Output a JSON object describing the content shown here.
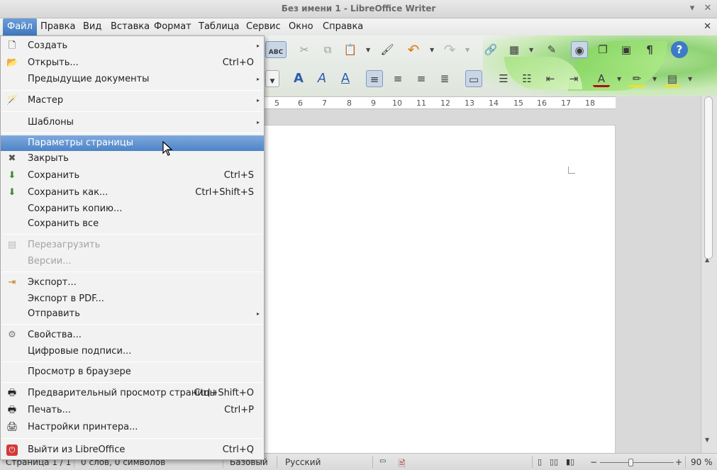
{
  "window": {
    "title": "Без имени 1 - LibreOffice Writer",
    "minimize_glyph": "▾",
    "close_glyph": "✕"
  },
  "menubar": {
    "items": [
      "Файл",
      "Правка",
      "Вид",
      "Вставка",
      "Формат",
      "Таблица",
      "Сервис",
      "Окно",
      "Справка"
    ],
    "close_doc_glyph": "✕"
  },
  "toolbar": {
    "abc_label": "ABC",
    "pilcrow": "¶",
    "help": "?",
    "fontwork_letter": "A"
  },
  "ruler": {
    "numbers": [
      "5",
      "6",
      "7",
      "8",
      "9",
      "10",
      "11",
      "12",
      "13",
      "14",
      "15",
      "16",
      "17",
      "18"
    ]
  },
  "file_menu": {
    "items": [
      {
        "label": "Создать",
        "shortcut": "",
        "submenu": true,
        "icon": "new-document-icon",
        "disabled": false,
        "highlighted": false
      },
      {
        "label": "Открыть...",
        "shortcut": "Ctrl+O",
        "submenu": false,
        "icon": "open-folder-icon",
        "disabled": false,
        "highlighted": false
      },
      {
        "label": "Предыдущие документы",
        "shortcut": "",
        "submenu": true,
        "icon": "",
        "disabled": false,
        "highlighted": false
      },
      {
        "label": "Мастер",
        "shortcut": "",
        "submenu": true,
        "icon": "wizard-icon",
        "disabled": false,
        "highlighted": false
      },
      {
        "label": "Шаблоны",
        "shortcut": "",
        "submenu": true,
        "icon": "",
        "disabled": false,
        "highlighted": false
      },
      {
        "label": "Параметры страницы",
        "shortcut": "",
        "submenu": false,
        "icon": "",
        "disabled": false,
        "highlighted": true
      },
      {
        "label": "Закрыть",
        "shortcut": "",
        "submenu": false,
        "icon": "close-x-icon",
        "disabled": false,
        "highlighted": false
      },
      {
        "label": "Сохранить",
        "shortcut": "Ctrl+S",
        "submenu": false,
        "icon": "save-icon",
        "disabled": false,
        "highlighted": false
      },
      {
        "label": "Сохранить как...",
        "shortcut": "Ctrl+Shift+S",
        "submenu": false,
        "icon": "save-as-icon",
        "disabled": false,
        "highlighted": false
      },
      {
        "label": "Сохранить копию...",
        "shortcut": "",
        "submenu": false,
        "icon": "",
        "disabled": false,
        "highlighted": false
      },
      {
        "label": "Сохранить все",
        "shortcut": "",
        "submenu": false,
        "icon": "",
        "disabled": false,
        "highlighted": false
      },
      {
        "label": "Перезагрузить",
        "shortcut": "",
        "submenu": false,
        "icon": "reload-icon",
        "disabled": true,
        "highlighted": false
      },
      {
        "label": "Версии...",
        "shortcut": "",
        "submenu": false,
        "icon": "",
        "disabled": true,
        "highlighted": false
      },
      {
        "label": "Экспорт...",
        "shortcut": "",
        "submenu": false,
        "icon": "export-icon",
        "disabled": false,
        "highlighted": false
      },
      {
        "label": "Экспорт в PDF...",
        "shortcut": "",
        "submenu": false,
        "icon": "",
        "disabled": false,
        "highlighted": false
      },
      {
        "label": "Отправить",
        "shortcut": "",
        "submenu": true,
        "icon": "",
        "disabled": false,
        "highlighted": false
      },
      {
        "label": "Свойства...",
        "shortcut": "",
        "submenu": false,
        "icon": "properties-gear-icon",
        "disabled": false,
        "highlighted": false
      },
      {
        "label": "Цифровые подписи...",
        "shortcut": "",
        "submenu": false,
        "icon": "",
        "disabled": false,
        "highlighted": false
      },
      {
        "label": "Просмотр в браузере",
        "shortcut": "",
        "submenu": false,
        "icon": "",
        "disabled": false,
        "highlighted": false
      },
      {
        "label": "Предварительный просмотр страницы",
        "shortcut": "Ctrl+Shift+O",
        "submenu": false,
        "icon": "print-preview-icon",
        "disabled": false,
        "highlighted": false
      },
      {
        "label": "Печать...",
        "shortcut": "Ctrl+P",
        "submenu": false,
        "icon": "printer-icon",
        "disabled": false,
        "highlighted": false
      },
      {
        "label": "Настройки принтера...",
        "shortcut": "",
        "submenu": false,
        "icon": "printer-settings-icon",
        "disabled": false,
        "highlighted": false
      },
      {
        "label": "Выйти из LibreOffice",
        "shortcut": "Ctrl+Q",
        "submenu": false,
        "icon": "power-icon",
        "disabled": false,
        "highlighted": false
      }
    ]
  },
  "statusbar": {
    "page": "Страница 1 / 1",
    "words": "0 слов, 0 символов",
    "style": "Базовый",
    "language": "Русский",
    "zoom": "90 %",
    "zoom_minus": "−",
    "zoom_plus": "+"
  },
  "colors": {
    "accent": "#4d84c8",
    "highlight_text": "#ffffff"
  }
}
